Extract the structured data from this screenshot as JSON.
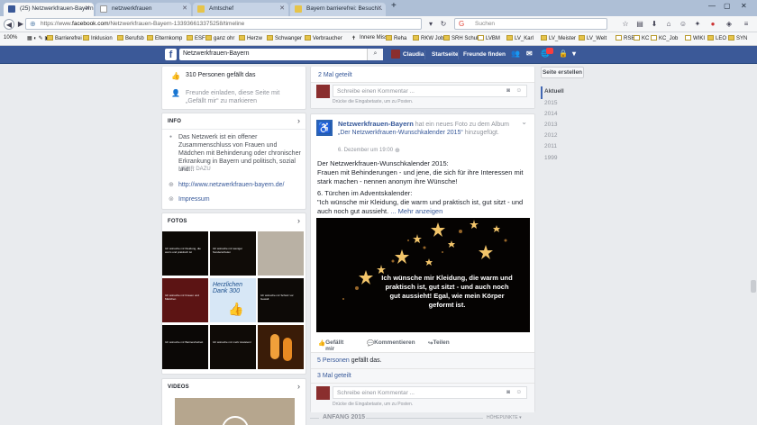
{
  "browser": {
    "tabs": [
      {
        "label": "(25) Netzwerkfrauen-Bayern",
        "active": true
      },
      {
        "label": "netzwerkfrauen",
        "active": false
      },
      {
        "label": "Amtschef",
        "active": false
      },
      {
        "label": "Bayern barrierefrei: Besuch...",
        "active": false
      }
    ],
    "new_tab": "+",
    "url_prefix": "https://www.",
    "url_domain": "facebook.com",
    "url_rest": "/Netzwerkfrauen-Bayern-133936613375258/timeline",
    "search_placeholder": "Suchen",
    "zoom": "100%",
    "bookmarks": [
      "Barrierefrei",
      "Inklusion",
      "Berufsb",
      "Elternkomp",
      "ESF",
      "ganz ohr",
      "Herzw",
      "Schwanger",
      "Verbraucher",
      "Innere Miss",
      "Reha",
      "RKW Job",
      "SRH Schule",
      "LVBM",
      "LV_Karl",
      "LV_Meister",
      "LV_Welt",
      "RSB",
      "KC",
      "KC_Job",
      "WIKI",
      "LEO",
      "SYN"
    ]
  },
  "fb": {
    "logo": "f",
    "search_value": "Netzwerkfrauen-Bayern",
    "user": "Claudia",
    "nav_home": "Startseite",
    "nav_friends": "Freunde finden"
  },
  "left": {
    "likes": "310 Personen gefällt das",
    "invite": "Freunde einladen, diese Seite mit „Gefällt mir“ zu markieren",
    "info_header": "INFO",
    "info_text": "Das Netzwerk ist ein offener Zusammenschluss von Frauen und Mädchen mit Behinderung oder chronischer Erkrankung in Bayern und politisch, sozial und...",
    "more": "MEHR DAZU",
    "website": "http://www.netzwerkfrauen-bayern.de/",
    "impressum": "Impressum",
    "photos_header": "FOTOS",
    "photos": [
      {
        "caption": "Ich wünsche mir Kleidung, die warm und praktisch ist",
        "bg": "#0c0906"
      },
      {
        "caption": "Ich wünsche mir weniger Sonderschulen",
        "bg": "#100c08"
      },
      {
        "caption": "",
        "bg": "#b9b1a4"
      },
      {
        "caption": "Ich wünsche mir Frauen und Mädchen",
        "bg": "#5c1414"
      },
      {
        "caption": "Herzlichen Dank 300",
        "bg": "#d7e7f6"
      },
      {
        "caption": "Ich wünsche mir Schutz vor Gewalt",
        "bg": "#0d0a07"
      },
      {
        "caption": "Ich wünsche mir Barrierefreiheit",
        "bg": "#0b0806"
      },
      {
        "caption": "Ich wünsche mir mehr Assistenz",
        "bg": "#0f0b07"
      },
      {
        "caption": "",
        "bg": "#3a1c08"
      }
    ],
    "videos_header": "VIDEOS"
  },
  "timeline": {
    "top_shared": "2 Mal geteilt",
    "comment_placeholder": "Schreibe einen Kommentar ...",
    "enter_hint": "Drücke die Eingabetaste, um zu Posten.",
    "post": {
      "page": "Netzwerkfrauen-Bayern",
      "action_pre": " hat ein neues Foto zu dem Album ",
      "album": "„Der Netzwerkfrauen-Wunschkalender 2015“",
      "action_post": " hinzugefügt.",
      "date": "6. Dezember um 19:00",
      "line1": "Der Netzwerkfrauen-Wunschkalender 2015:",
      "line2": "Frauen mit Behinderungen - und jene, die sich für ihre Interessen mit stark machen - nennen anonym ihre Wünsche!",
      "line3": "6. Türchen im Adventskalender:",
      "line4": "\"Ich wünsche mir Kleidung, die warm und praktisch ist, gut sitzt - und auch noch gut aussieht.",
      "more": "... Mehr anzeigen",
      "image_text": "Ich wünsche mir Kleidung, die warm und praktisch ist, gut sitzt - und auch noch gut aussieht! Egal, wie mein Körper geformt ist.",
      "like": "Gefällt mir",
      "comment": "Kommentieren",
      "share": "Teilen",
      "likes_count": "5 Personen",
      "likes_suffix": " gefällt das.",
      "shared": "3 Mal geteilt"
    },
    "year_divider": "ANFANG 2015",
    "highlights": "HÖHEPUNKTE ▾"
  },
  "right": {
    "create_page": "Seite erstellen",
    "years": [
      "Aktuell",
      "2015",
      "2014",
      "2013",
      "2012",
      "2011",
      "1999"
    ]
  }
}
